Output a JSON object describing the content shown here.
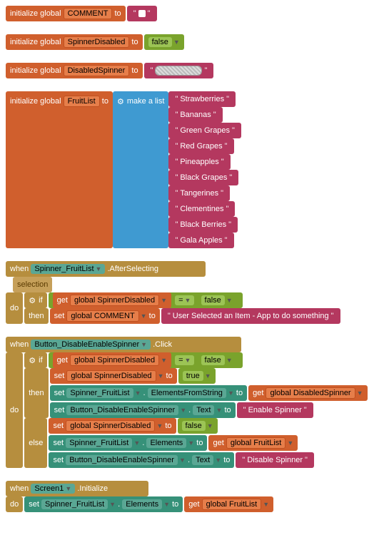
{
  "init": {
    "label": "initialize global",
    "to": "to",
    "comment": {
      "name": "COMMENT",
      "valueType": "square"
    },
    "spinnerDisabled": {
      "name": "SpinnerDisabled",
      "value": "false"
    },
    "disabledSpinner": {
      "name": "DisabledSpinner",
      "valueType": "hatched"
    },
    "fruitList": {
      "name": "FruitList",
      "makeList": "make a list",
      "items": [
        "Strawberries",
        "Bananas",
        "Green Grapes",
        "Red Grapes",
        "Pineapples",
        "Black Grapes",
        "Tangerines",
        "Clementines",
        "Black Berries",
        "Gala Apples"
      ]
    }
  },
  "afterSelecting": {
    "when": "when",
    "component": "Spinner_FruitList",
    "event": ".AfterSelecting",
    "selection": "selection",
    "do": "do",
    "if": "if",
    "then": "then",
    "get": "get",
    "getVar": "global SpinnerDisabled",
    "op": "=",
    "rhs": "false",
    "set": "set",
    "setVar": "global COMMENT",
    "to": "to",
    "msg": "User Selected an Item - App to do something"
  },
  "buttonClick": {
    "when": "when",
    "component": "Button_DisableEnableSpinner",
    "event": ".Click",
    "do": "do",
    "if": "if",
    "then": "then",
    "else": "else",
    "get": "get",
    "getVar": "global SpinnerDisabled",
    "op": "=",
    "rhs": "false",
    "set": "set",
    "to": "to",
    "thenBlock": {
      "setVar": "global SpinnerDisabled",
      "setVal": "true",
      "setCompA": "Spinner_FruitList",
      "setPropA": "ElementsFromString",
      "getA": "global DisabledSpinner",
      "setCompB": "Button_DisableEnableSpinner",
      "setPropB": "Text",
      "textB": "Enable Spinner"
    },
    "elseBlock": {
      "setVar": "global SpinnerDisabled",
      "setVal": "false",
      "setCompA": "Spinner_FruitList",
      "setPropA": "Elements",
      "getA": "global FruitList",
      "setCompB": "Button_DisableEnableSpinner",
      "setPropB": "Text",
      "textB": "Disable Spinner"
    }
  },
  "screenInit": {
    "when": "when",
    "component": "Screen1",
    "event": ".Initialize",
    "do": "do",
    "set": "set",
    "comp": "Spinner_FruitList",
    "prop": "Elements",
    "to": "to",
    "get": "get",
    "getVar": "global FruitList"
  }
}
